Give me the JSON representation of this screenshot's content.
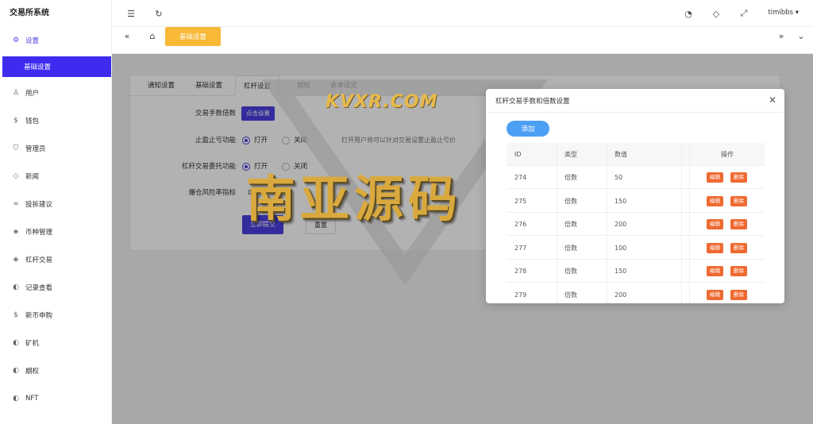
{
  "app": {
    "title": "交易所系统"
  },
  "sidebar": {
    "items": [
      {
        "label": "设置",
        "icon": "gear-icon",
        "glyph": "⚙"
      },
      {
        "label": "用户",
        "icon": "user-icon",
        "glyph": "♙"
      },
      {
        "label": "钱包",
        "icon": "dollar-icon",
        "glyph": "$"
      },
      {
        "label": "管理员",
        "icon": "shield-icon",
        "glyph": "⛉"
      },
      {
        "label": "新闻",
        "icon": "tag-icon",
        "glyph": "◇"
      },
      {
        "label": "投拆建议",
        "icon": "link-icon",
        "glyph": "∞"
      },
      {
        "label": "币种管理",
        "icon": "diamond-icon",
        "glyph": "◈"
      },
      {
        "label": "杠杆交易",
        "icon": "diamond-icon",
        "glyph": "◈"
      },
      {
        "label": "记录查看",
        "icon": "back-circle-icon",
        "glyph": "◐"
      },
      {
        "label": "新币申购",
        "icon": "dollar-circle-icon",
        "glyph": "$"
      },
      {
        "label": "矿机",
        "icon": "back-circle-icon",
        "glyph": "◐"
      },
      {
        "label": "期权",
        "icon": "back-circle-icon",
        "glyph": "◐"
      },
      {
        "label": "NFT",
        "icon": "back-circle-icon",
        "glyph": "◐"
      }
    ],
    "active_sub": "基础设置"
  },
  "header": {
    "username": "timibbs"
  },
  "tabbar": {
    "active_tag": "基础设置"
  },
  "content": {
    "tabs": [
      "通知设置",
      "基础设置",
      "杠杆设置",
      "期权",
      "表单设定"
    ],
    "form": {
      "row1_label": "交易手数倍数",
      "row1_btn": "点击设置",
      "row2_label": "止盈止亏功能",
      "row2_on": "打开",
      "row2_off": "关闭",
      "row2_hint": "打开用户将可以针对交易设置止盈止亏价",
      "row3_label": "杠杆交易委托功能",
      "row3_on": "打开",
      "row3_off": "关闭",
      "row4_label": "爆仓风险率指标",
      "row4_value": "0",
      "submit": "立即提交",
      "reset": "重置"
    }
  },
  "modal": {
    "title": "杠杆交易手数和倍数设置",
    "add_label": "添加",
    "columns": [
      "ID",
      "类型",
      "数值",
      "操作"
    ],
    "rows": [
      {
        "id": "274",
        "type": "倍数",
        "value": "50"
      },
      {
        "id": "275",
        "type": "倍数",
        "value": "150"
      },
      {
        "id": "276",
        "type": "倍数",
        "value": "200"
      },
      {
        "id": "277",
        "type": "倍数",
        "value": "100"
      },
      {
        "id": "278",
        "type": "倍数",
        "value": "150"
      },
      {
        "id": "279",
        "type": "倍数",
        "value": "200"
      }
    ],
    "edit_label": "编辑",
    "delete_label": "删除"
  },
  "watermark": {
    "small": "KVXR.COM",
    "big": "南亚源码"
  },
  "colors": {
    "primary": "#4b3fe0",
    "tag": "#f7b936",
    "add": "#4d9ff5",
    "danger": "#ef6a32"
  }
}
